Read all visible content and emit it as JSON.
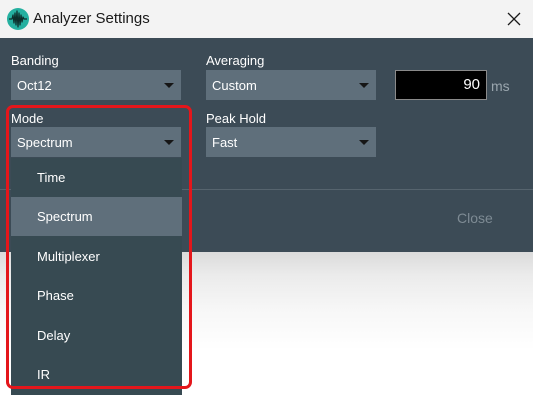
{
  "window": {
    "title": "Analyzer Settings"
  },
  "banding": {
    "label": "Banding",
    "value": "Oct12"
  },
  "averaging": {
    "label": "Averaging",
    "value": "Custom",
    "time_value": "90",
    "time_unit": "ms"
  },
  "mode": {
    "label": "Mode",
    "value": "Spectrum",
    "options": [
      "Time",
      "Spectrum",
      "Multiplexer",
      "Phase",
      "Delay",
      "IR"
    ],
    "selected_index": 1
  },
  "peak_hold": {
    "label": "Peak Hold",
    "value": "Fast"
  },
  "footer": {
    "close_label": "Close"
  },
  "colors": {
    "accent_icon": "#25b0a0",
    "dialog_bg": "#3c4b56",
    "control_bg": "#5f6f7b",
    "dropdown_bg": "#374a52",
    "highlight_box": "#e4161b"
  },
  "icons": {
    "app": "waveform-icon",
    "close": "close-icon",
    "caret": "chevron-down-icon"
  }
}
